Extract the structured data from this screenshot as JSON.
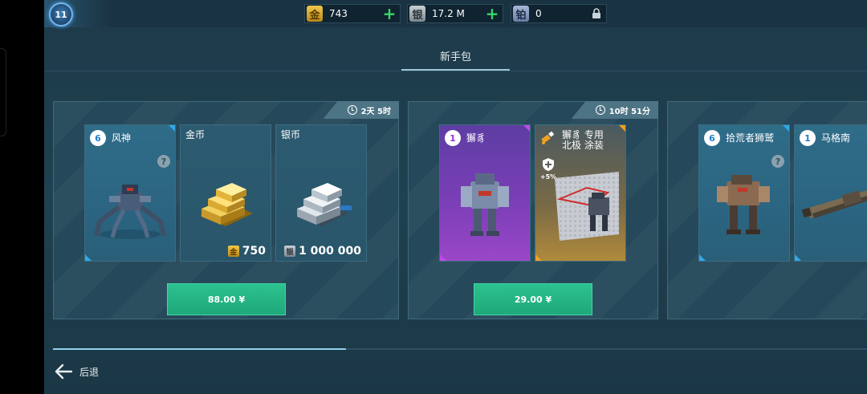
{
  "player": {
    "level": "11"
  },
  "currencies": [
    {
      "symbol": "金",
      "value": "743"
    },
    {
      "symbol": "银",
      "value": "17.2 M"
    },
    {
      "symbol": "铂",
      "value": "0"
    }
  ],
  "page_title": "新手包",
  "bundles": [
    {
      "timer": "2天 5时",
      "price": "88.00 ¥",
      "items": [
        {
          "level": "6",
          "name": "风神",
          "rarity": "epic-blue"
        },
        {
          "name": "金币",
          "amount": "750",
          "amount_symbol": "金"
        },
        {
          "name": "银币",
          "amount": "1 000 000",
          "amount_symbol": "银"
        }
      ]
    },
    {
      "timer": "10时 51分",
      "price": "29.00 ¥",
      "items": [
        {
          "level": "1",
          "name": "獬豸",
          "rarity": "legendary-purple"
        },
        {
          "name": "獬豸 专用\n北极 涂装",
          "boost": "+5%",
          "rarity": "orange"
        }
      ]
    },
    {
      "items": [
        {
          "level": "6",
          "name": "拾荒者狮鹫",
          "rarity": "epic-blue"
        },
        {
          "level": "1",
          "name": "马格南",
          "rarity": "epic-blue"
        }
      ]
    }
  ],
  "scroll_progress": 0.36,
  "back_label": "后退",
  "colors": {
    "accent_green": "#2cc28f",
    "epic_blue": "#2fa8e8",
    "legendary_purple": "#c04ae8",
    "skin_orange": "#f0a020"
  }
}
